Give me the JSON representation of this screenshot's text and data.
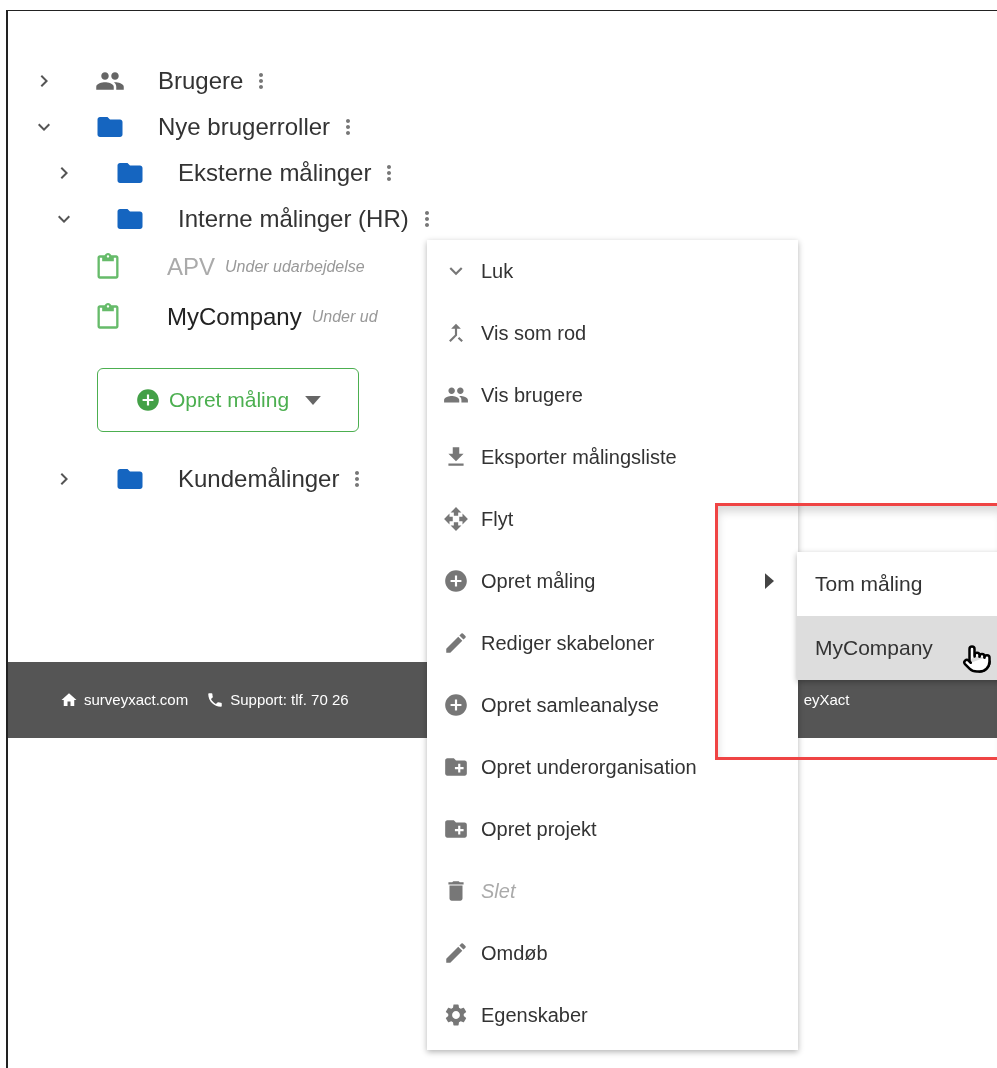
{
  "tree": [
    {
      "kind": "users",
      "label": "Brugere",
      "expanded": false
    },
    {
      "kind": "folder",
      "label": "Nye brugerroller",
      "expanded": true,
      "children": [
        {
          "kind": "folder",
          "label": "Eksterne målinger",
          "expanded": false
        },
        {
          "kind": "folder",
          "label": "Interne målinger (HR)",
          "expanded": true,
          "children": [
            {
              "kind": "survey",
              "label": "APV",
              "status": "Under udarbejdelse",
              "disabled": true
            },
            {
              "kind": "survey",
              "label": "MyCompany",
              "status": "Under ud",
              "disabled": false
            },
            {
              "kind": "button",
              "label": "Opret måling"
            }
          ]
        },
        {
          "kind": "folder",
          "label": "Kundemålinger",
          "expanded": false
        }
      ]
    }
  ],
  "footer": [
    {
      "kind": "home",
      "text": "surveyxact.com"
    },
    {
      "kind": "phone",
      "text": "Support: tlf. 70 26"
    },
    {
      "kind": "plain",
      "text": "eyXact"
    }
  ],
  "context_menu": [
    {
      "label": "Luk",
      "disabled": false
    },
    {
      "label": "Vis som rod",
      "disabled": false
    },
    {
      "label": "Vis brugere",
      "disabled": false
    },
    {
      "label": "Eksporter målingsliste",
      "disabled": false
    },
    {
      "label": "Flyt",
      "disabled": false
    },
    {
      "label": "Opret måling",
      "disabled": false,
      "submenu": true
    },
    {
      "label": "Rediger skabeloner",
      "disabled": false
    },
    {
      "label": "Opret samleanalyse",
      "disabled": false
    },
    {
      "label": "Opret underorganisation",
      "disabled": false
    },
    {
      "label": "Opret projekt",
      "disabled": false
    },
    {
      "label": "Slet",
      "disabled": true
    },
    {
      "label": "Omdøb",
      "disabled": false
    },
    {
      "label": "Egenskaber",
      "disabled": false
    }
  ],
  "submenu": [
    {
      "label": "Tom måling",
      "hovered": false
    },
    {
      "label": "MyCompany",
      "hovered": true
    }
  ]
}
